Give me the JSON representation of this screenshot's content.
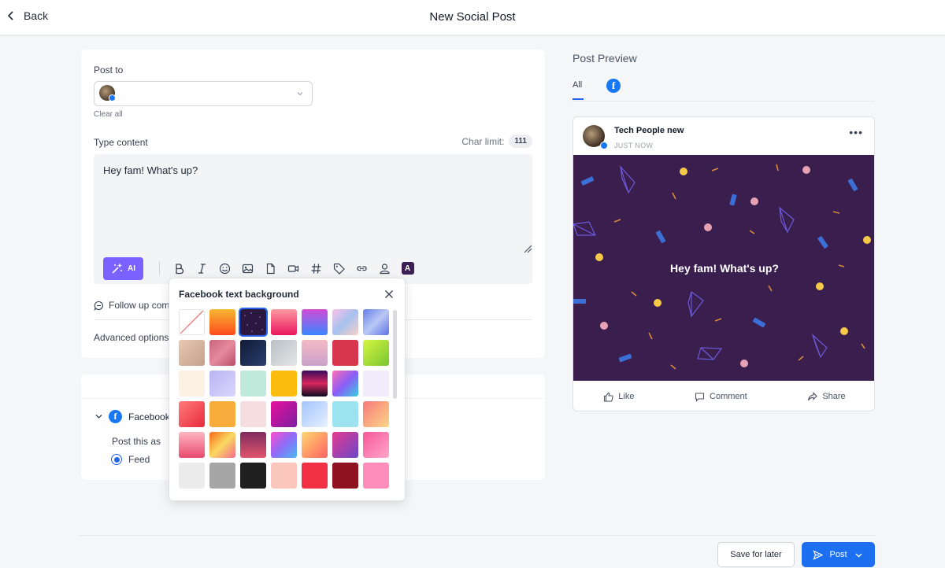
{
  "header": {
    "back_label": "Back",
    "title": "New Social Post"
  },
  "composer": {
    "post_to_label": "Post to",
    "clear_all": "Clear all",
    "type_content_label": "Type content",
    "char_limit_label": "Char limit:",
    "char_limit_value": "111",
    "content": "Hey fam! What's up?",
    "ai_label": "AI",
    "follow_up_label": "Follow up com",
    "advanced_label": "Advanced options"
  },
  "facebook_section": {
    "label": "Facebook",
    "post_as_label": "Post this as",
    "feed_label": "Feed"
  },
  "bg_popover": {
    "title": "Facebook text background",
    "swatches": [
      "none",
      "linear-gradient(180deg,#f7b733,#fc4a1a)",
      "#2b1740",
      "linear-gradient(180deg,#ff9aa2,#e9155e)",
      "linear-gradient(180deg,#d14bd8,#3a86ff)",
      "linear-gradient(135deg,#fbc2eb,#a6c1ee,#fad0c4)",
      "linear-gradient(135deg,#667eea,#b9c8f5,#5e72e4)",
      "linear-gradient(135deg,#e8c9b4,#c4a08a)",
      "linear-gradient(135deg,#c9657e,#e48a9d,#b94c67)",
      "linear-gradient(135deg,#0f1a36,#2b3f6e)",
      "linear-gradient(135deg,#b9bfc4,#e4e7e9)",
      "linear-gradient(180deg,#f5b9c5,#c9a2c9)",
      "#d7364f",
      "linear-gradient(135deg,#d6f542,#79c62f)",
      "#fdf1e4",
      "linear-gradient(135deg,#b9b4f5,#d9d6fb)",
      "#bfeadb",
      "#fbbc10",
      "linear-gradient(180deg,#3b0b5e,#d8265e,#0b0b20)",
      "linear-gradient(135deg,#ff6fb5,#8a5cf6,#36d1dc)",
      "#f1ebfb",
      "linear-gradient(135deg,#ff7b7b,#e8293f)",
      "#f8ac3c",
      "#f5dde0",
      "linear-gradient(135deg,#e8119b,#7b1fa2)",
      "linear-gradient(135deg,#a1c4fd,#e8f0ff)",
      "#9de2ef",
      "linear-gradient(135deg,#f7797d,#fbd786)",
      "linear-gradient(180deg,#ffb6c1,#e84a6f)",
      "linear-gradient(135deg,#f76b1c,#fad961,#f76b8a)",
      "linear-gradient(180deg,#7f2b5e,#e0556e)",
      "linear-gradient(135deg,#ff4ecd,#8e6cf7,#4bb8f4)",
      "linear-gradient(135deg,#ffd86f,#fc6262)",
      "linear-gradient(135deg,#e63b8f,#6b47c9)",
      "linear-gradient(135deg,#f6579b,#ffa6c9)",
      "#ececec",
      "#a6a6a6",
      "#1f1f1f",
      "#fbc7bd",
      "#f23045",
      "#8f1221",
      "#fe8dbb"
    ],
    "selected_index": 2
  },
  "preview": {
    "title": "Post Preview",
    "tab_all": "All",
    "account_name": "Tech People new",
    "timestamp": "JUST NOW",
    "post_text": "Hey fam! What's up?",
    "actions": {
      "like": "Like",
      "comment": "Comment",
      "share": "Share"
    }
  },
  "footer": {
    "save_label": "Save for later",
    "post_label": "Post"
  },
  "colors": {
    "accent": "#1d6ff2",
    "ai_button": "#7b61ff",
    "facebook_blue": "#1877f2",
    "post_background": "#3a1e4e"
  }
}
